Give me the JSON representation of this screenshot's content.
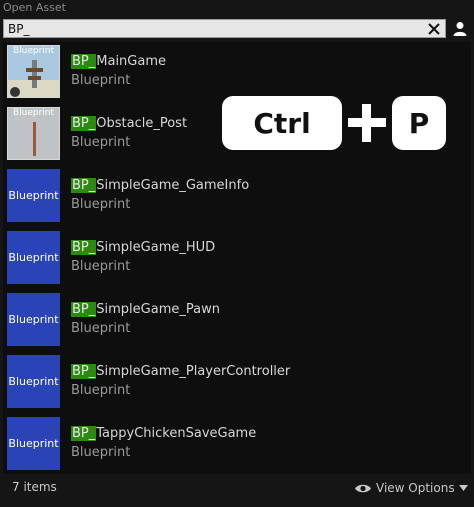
{
  "panel": {
    "title": "Open Asset"
  },
  "search": {
    "value": "BP_",
    "placeholder": ""
  },
  "assets": [
    {
      "prefix": "BP_",
      "name": "MainGame",
      "type": "Blueprint",
      "thumb": "scene",
      "thumb_label": "Blueprint"
    },
    {
      "prefix": "BP_",
      "name": "Obstacle_Post",
      "type": "Blueprint",
      "thumb": "scene",
      "thumb_label": "Blueprint"
    },
    {
      "prefix": "BP_",
      "name": "SimpleGame_GameInfo",
      "type": "Blueprint",
      "thumb": "plain",
      "thumb_label": "Blueprint"
    },
    {
      "prefix": "BP_",
      "name": "SimpleGame_HUD",
      "type": "Blueprint",
      "thumb": "plain",
      "thumb_label": "Blueprint"
    },
    {
      "prefix": "BP_",
      "name": "SimpleGame_Pawn",
      "type": "Blueprint",
      "thumb": "plain",
      "thumb_label": "Blueprint"
    },
    {
      "prefix": "BP_",
      "name": "SimpleGame_PlayerController",
      "type": "Blueprint",
      "thumb": "plain",
      "thumb_label": "Blueprint"
    },
    {
      "prefix": "BP_",
      "name": "TappyChickenSaveGame",
      "type": "Blueprint",
      "thumb": "plain",
      "thumb_label": "Blueprint"
    }
  ],
  "footer": {
    "count": "7 items",
    "view_options": "View Options"
  },
  "shortcut": {
    "key1": "Ctrl",
    "key2": "P"
  },
  "colors": {
    "highlight": "#2c8a12",
    "blueprint_thumb": "#2a44b8",
    "background": "#151515"
  },
  "icons": {
    "clear": "close-icon",
    "user": "user-icon",
    "view": "eye-icon",
    "dropdown": "caret-down-icon"
  }
}
